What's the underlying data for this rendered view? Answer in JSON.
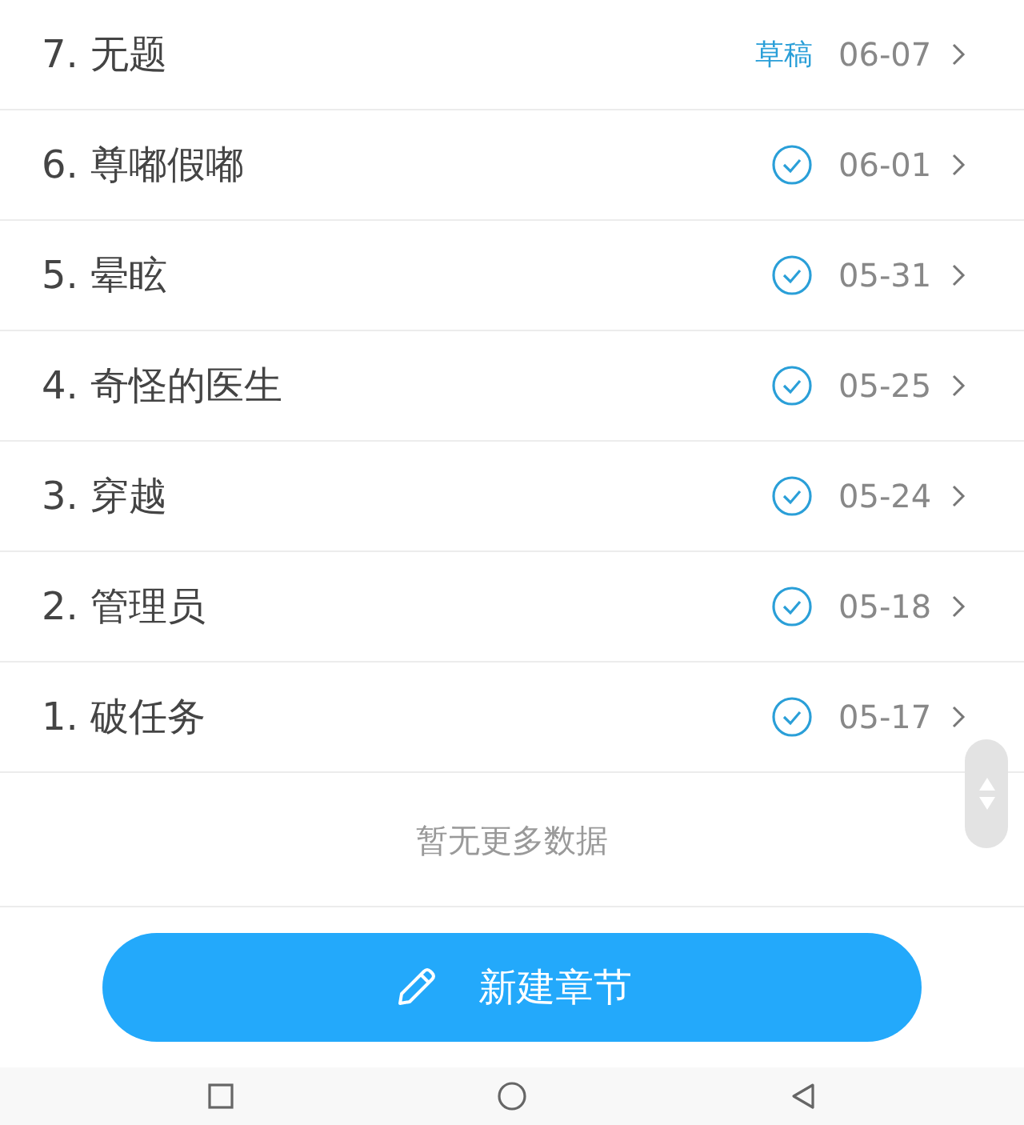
{
  "chapters": [
    {
      "title": "7. 无题",
      "kind": "draft",
      "status_label": "草稿",
      "date": "06-07"
    },
    {
      "title": "6. 尊嘟假嘟",
      "kind": "published",
      "date": "06-01"
    },
    {
      "title": "5. 晕眩",
      "kind": "published",
      "date": "05-31"
    },
    {
      "title": "4. 奇怪的医生",
      "kind": "published",
      "date": "05-25"
    },
    {
      "title": "3. 穿越",
      "kind": "published",
      "date": "05-24"
    },
    {
      "title": "2. 管理员",
      "kind": "published",
      "date": "05-18"
    },
    {
      "title": "1. 破任务",
      "kind": "published",
      "date": "05-17"
    }
  ],
  "footer_note": "暂无更多数据",
  "new_button": {
    "label": "新建章节"
  }
}
